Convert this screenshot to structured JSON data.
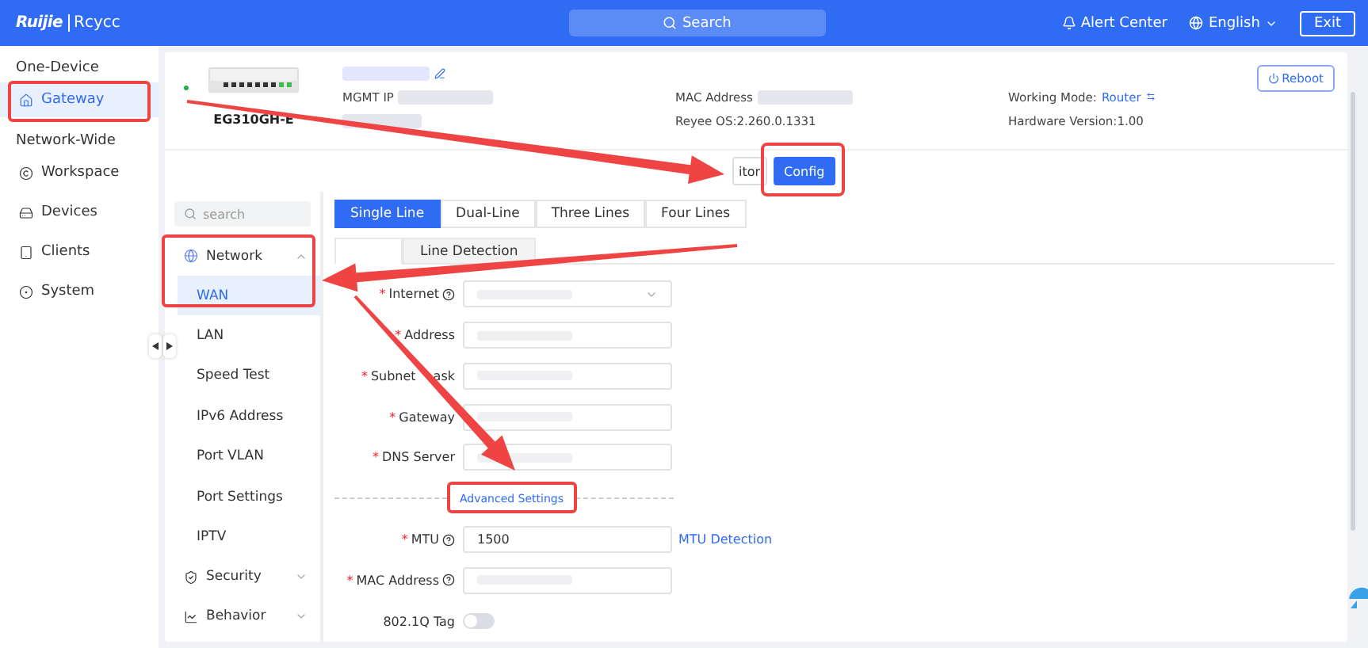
{
  "header": {
    "brand": "Ruijie",
    "product": "Rcycc",
    "search": {
      "placeholder": "Search"
    },
    "alert": "Alert Center",
    "language": "English",
    "exit": "Exit"
  },
  "sidebar": [
    {
      "title": "One-Device",
      "items": [
        {
          "label": "Gateway",
          "selected": true
        }
      ]
    },
    {
      "title": "Network-Wide",
      "items": [
        {
          "label": "Workspace",
          "selected": false
        },
        {
          "label": "Devices",
          "selected": false
        },
        {
          "label": "Clients",
          "selected": false
        },
        {
          "label": "System",
          "selected": false
        }
      ]
    }
  ],
  "device": {
    "model": "EG310GH-E",
    "online": true,
    "mgmt_ip_label": "MGMT IP",
    "mac_label": "MAC Address",
    "os": "Reyee OS:2.260.0.1331",
    "mode_label": "Working Mode:",
    "mode": "Router",
    "hardware": "Hardware Version:1.00",
    "reboot": "Reboot"
  },
  "view_tabs": [
    {
      "label": "itor",
      "selected": false
    },
    {
      "label": "Config",
      "selected": true
    }
  ],
  "menu": {
    "search": {
      "placeholder": "search"
    },
    "items": [
      {
        "label": "Network",
        "expanded": true,
        "children": [
          {
            "label": "WAN",
            "selected": true
          },
          {
            "label": "LAN",
            "selected": false
          },
          {
            "label": "Speed Test",
            "selected": false
          },
          {
            "label": "IPv6 Address",
            "selected": false
          },
          {
            "label": "Port VLAN",
            "selected": false
          },
          {
            "label": "Port Settings",
            "selected": false
          },
          {
            "label": "IPTV",
            "selected": false
          }
        ]
      },
      {
        "label": "Security",
        "expanded": false
      },
      {
        "label": "Behavior",
        "expanded": false
      }
    ]
  },
  "line_tabs": [
    {
      "label": "Single Line",
      "selected": true
    },
    {
      "label": "Dual-Line",
      "selected": false
    },
    {
      "label": "Three Lines",
      "selected": false
    },
    {
      "label": "Four Lines",
      "selected": false
    }
  ],
  "sub_tabs": [
    {
      "selected": true
    },
    {
      "label": "Line Detection",
      "selected": false
    }
  ],
  "form": [
    {
      "kind": "select",
      "required_mark": "*",
      "label": "Internet",
      "help": true
    },
    {
      "kind": "input",
      "required_mark": "*",
      "label": "Address",
      "help": false
    },
    {
      "kind": "input",
      "required_mark": "*",
      "label": "Subnet",
      "label_tail": "ask",
      "help": false
    },
    {
      "kind": "input",
      "required_mark": "*",
      "label": "Gateway",
      "help": false
    },
    {
      "kind": "input",
      "required_mark": "*",
      "label": "DNS Server",
      "help": false
    },
    {
      "kind": "divider",
      "label": "Advanced Settings"
    },
    {
      "kind": "input",
      "required_mark": "*",
      "label": "MTU",
      "help": true,
      "value": "1500",
      "action": "MTU Detection"
    },
    {
      "kind": "input",
      "required_mark": "*",
      "label": "MAC Address",
      "help": true
    },
    {
      "kind": "toggle",
      "label": "802.1Q Tag",
      "help": false,
      "on": false
    }
  ]
}
